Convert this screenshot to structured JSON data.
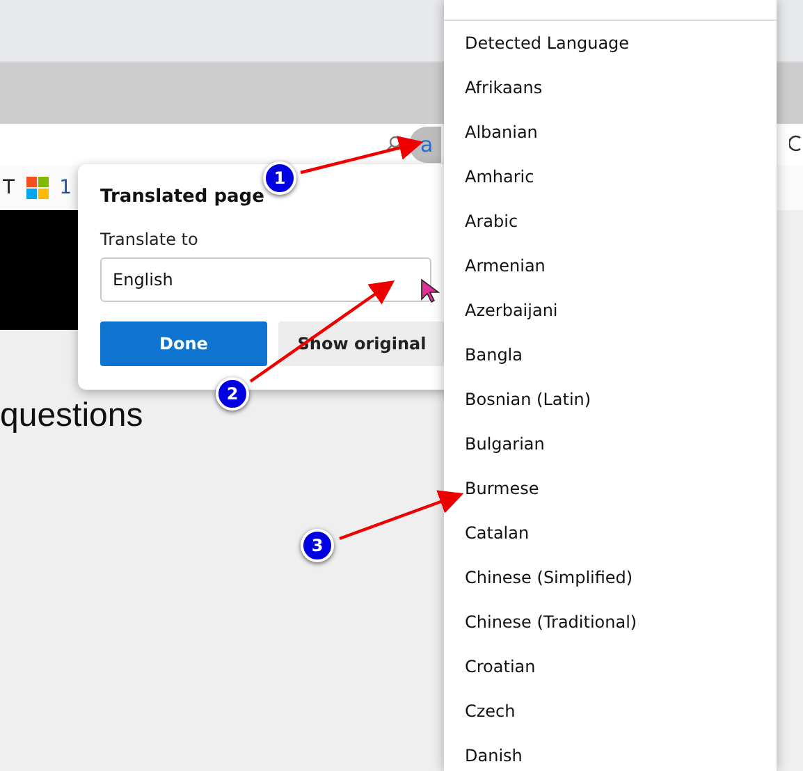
{
  "browser": {
    "translate_button": "a",
    "bookmarks": [
      "T",
      "1"
    ]
  },
  "page": {
    "heading": "questions"
  },
  "popup": {
    "title": "Translated page",
    "label": "Translate to",
    "select_value": "English",
    "buttons": [
      {
        "label": "Done",
        "kind": "primary"
      },
      {
        "label": "Show original",
        "kind": "secondary"
      }
    ]
  },
  "dropdown": {
    "options": [
      "Detected Language",
      "Afrikaans",
      "Albanian",
      "Amharic",
      "Arabic",
      "Armenian",
      "Azerbaijani",
      "Bangla",
      "Bosnian (Latin)",
      "Bulgarian",
      "Burmese",
      "Catalan",
      "Chinese (Simplified)",
      "Chinese (Traditional)",
      "Croatian",
      "Czech",
      "Danish"
    ]
  },
  "annotations": [
    "1",
    "2",
    "3"
  ]
}
